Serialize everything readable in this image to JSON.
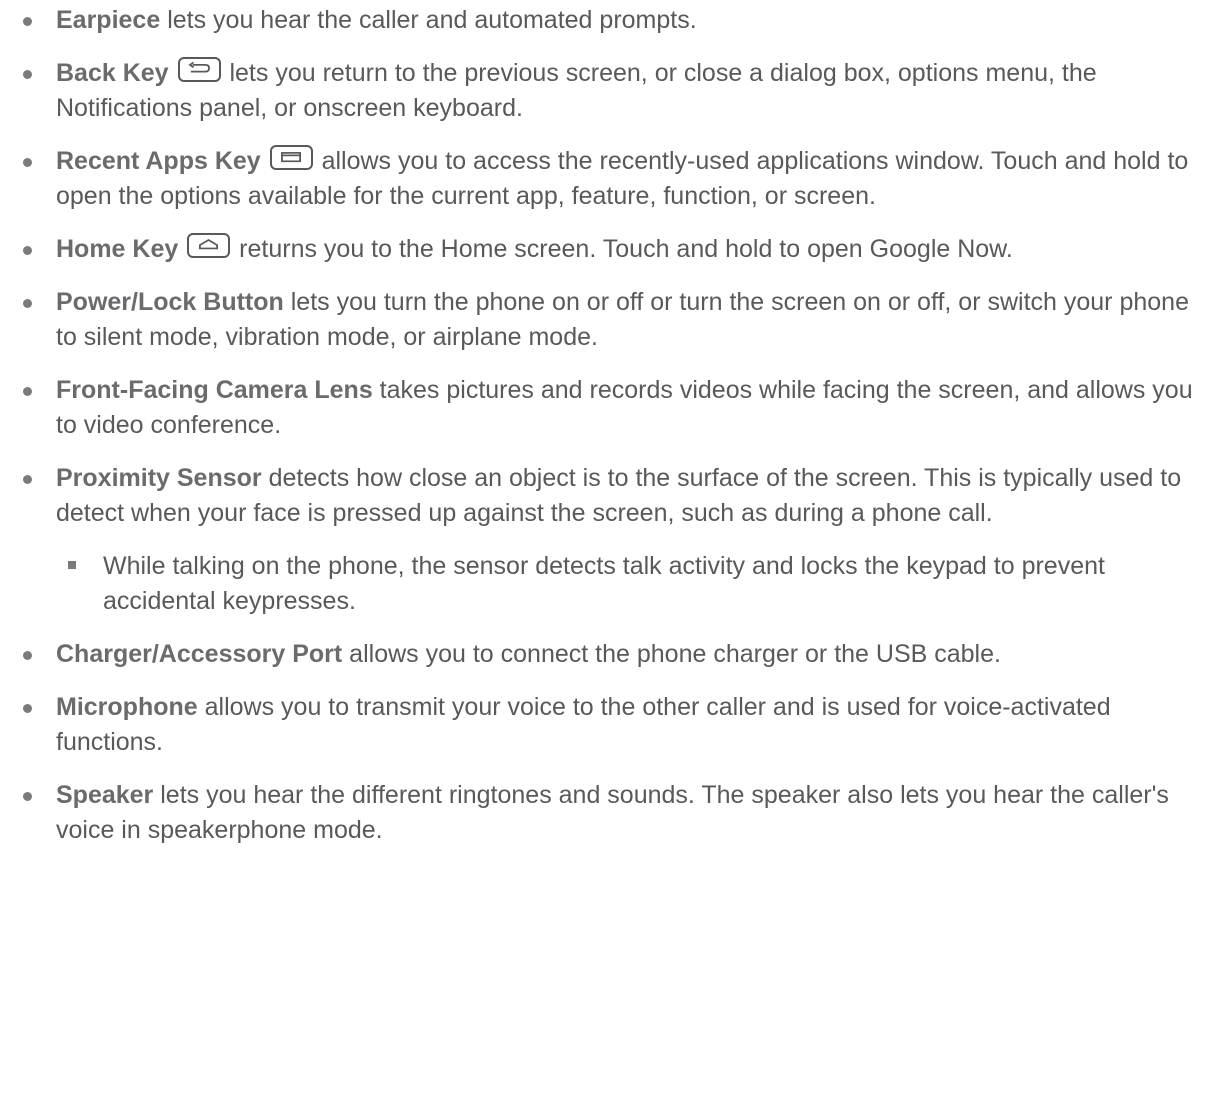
{
  "items": [
    {
      "term": "Earpiece",
      "text": " lets you hear the caller and automated prompts."
    },
    {
      "term": "Back Key",
      "icon": "back-key-icon",
      "text": " lets you return to the previous screen, or close a dialog box, options menu, the Notifications panel, or onscreen keyboard."
    },
    {
      "term": "Recent Apps Key",
      "icon": "recent-apps-key-icon",
      "text": " allows you to access the recently-used applications window. Touch and hold to open the options available for the current app, feature, function, or screen."
    },
    {
      "term": "Home Key",
      "icon": "home-key-icon",
      "text": " returns you to the Home screen. Touch and hold to open Google Now."
    },
    {
      "term": "Power/Lock Button",
      "text": " lets you turn the phone on or off or turn the screen on or off, or switch your phone to silent mode, vibration mode, or airplane mode."
    },
    {
      "term": "Front-Facing Camera Lens",
      "text": " takes pictures and records videos while facing the screen, and allows you to video conference."
    },
    {
      "term": "Proximity Sensor",
      "text": " detects how close an object is to the surface of the screen. This is typically used to detect when your face is pressed up against the screen, such as during a phone call."
    },
    {
      "sub": true,
      "text": "While talking on the phone, the sensor detects talk activity and locks the keypad to prevent accidental keypresses."
    },
    {
      "term": "Charger/Accessory Port",
      "text": " allows you to connect the phone charger or the USB cable."
    },
    {
      "term": "Microphone",
      "text": " allows you to transmit your voice to the other caller and is used for voice-activated functions."
    },
    {
      "term": "Speaker",
      "text": " lets you hear the different ringtones and sounds. The speaker also lets you hear the caller's voice in speakerphone mode."
    }
  ]
}
